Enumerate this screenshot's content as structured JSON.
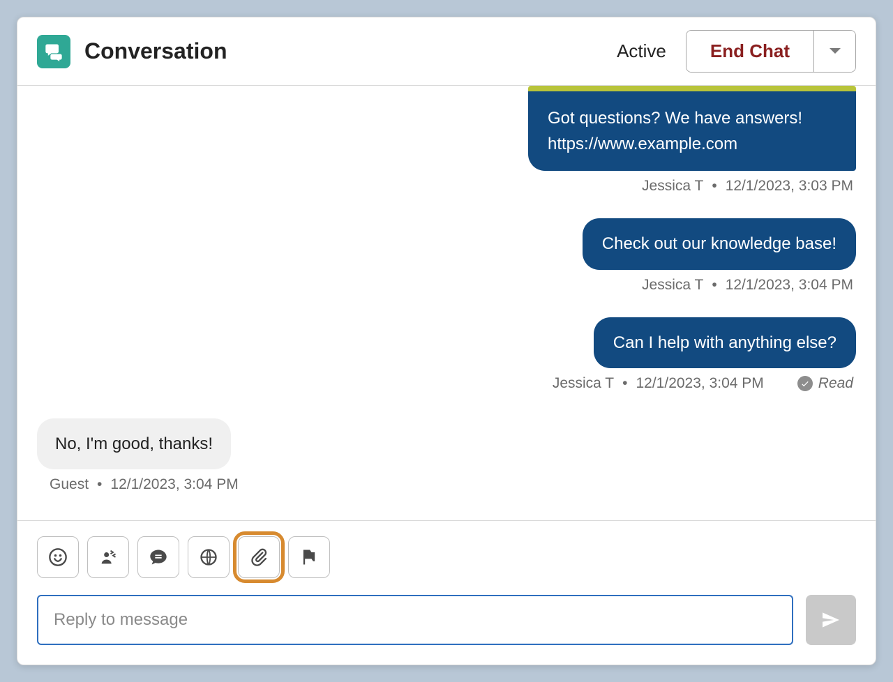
{
  "header": {
    "title": "Conversation",
    "status": "Active",
    "end_chat_label": "End Chat"
  },
  "messages": {
    "m1": {
      "line1": "Got questions? We have answers!",
      "line2": "https://www.example.com",
      "author": "Jessica T",
      "timestamp": "12/1/2023, 3:03 PM"
    },
    "m2": {
      "text": "Check out our knowledge base!",
      "author": "Jessica T",
      "timestamp": "12/1/2023, 3:04 PM"
    },
    "m3": {
      "text": "Can I help with anything else?",
      "author": "Jessica T",
      "timestamp": "12/1/2023, 3:04 PM",
      "read_label": "Read"
    },
    "m4": {
      "text": "No, I'm good, thanks!",
      "author": "Guest",
      "timestamp": "12/1/2023, 3:04 PM"
    }
  },
  "composer": {
    "placeholder": "Reply to message"
  },
  "icons": {
    "conversation": "chat-icon",
    "dropdown": "chevron-down-icon",
    "emoji": "smiley-icon",
    "transfer": "transfer-user-icon",
    "message": "message-icon",
    "world": "translate-icon",
    "attach": "paperclip-icon",
    "flag": "flag-icon",
    "send": "send-icon",
    "check": "check-icon"
  }
}
